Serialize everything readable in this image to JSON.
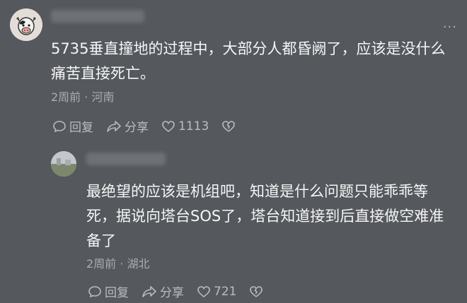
{
  "colors": {
    "background": "#55585c",
    "text": "#f5f6f7",
    "meta": "#a9adb1",
    "action": "#b9bdc1"
  },
  "comments": [
    {
      "avatar_icon": "cow-avatar-icon",
      "text_lines": [
        "5735垂直撞地的过程中，大部分人都昏阙了，应该是没什么",
        "痛苦直接死亡。"
      ],
      "time": "2周前",
      "separator": "·",
      "location": "河南",
      "reply_label": "回复",
      "share_label": "分享",
      "like_count": "1113"
    },
    {
      "avatar_icon": "landscape-avatar-icon",
      "text_lines": [
        "最绝望的应该是机组吧，知道是什么问题只能乖乖等",
        "死，据说向塔台SOS了，塔台知道接到后直接做空难准",
        "备了"
      ],
      "time": "2周前",
      "separator": "·",
      "location": "湖北",
      "reply_label": "回复",
      "share_label": "分享",
      "like_count": "721"
    }
  ]
}
